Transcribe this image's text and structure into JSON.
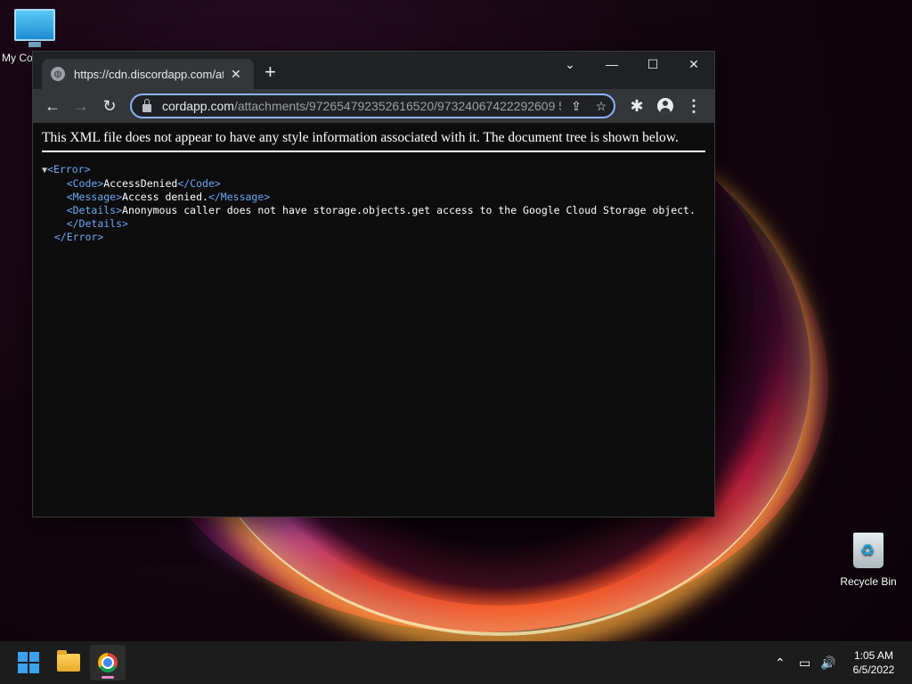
{
  "desktop": {
    "icons": [
      {
        "label": "My Co",
        "icon": "monitor-icon"
      },
      {
        "label": "Recycle Bin",
        "icon": "recycle-bin-icon"
      }
    ]
  },
  "browser": {
    "tab": {
      "title": "https://cdn.discordapp.com/attac",
      "favicon": "globe-icon",
      "close": "✕"
    },
    "new_tab": "+",
    "window_controls": {
      "tab_search": "⌄",
      "minimize": "—",
      "maximize": "☐",
      "close": "✕"
    },
    "toolbar": {
      "back": "←",
      "forward": "→",
      "reload": "↻"
    },
    "address": {
      "host": "cordapp.com",
      "path": "/attachments/972654792352616520/97324067422292609 5"
    },
    "omnibox_icons": {
      "share": "⇪",
      "bookmark": "☆"
    },
    "extensions": "✱",
    "menu": "⋮"
  },
  "page": {
    "banner": "This XML file does not appear to have any style information associated with it. The document tree is shown below.",
    "xml": {
      "toggle": "▼",
      "error_open": "<Error>",
      "code_open": "<Code>",
      "code_value": "AccessDenied",
      "code_close": "</Code>",
      "message_open": "<Message>",
      "message_value": "Access denied.",
      "message_close": "</Message>",
      "details_open": "<Details>",
      "details_value": "Anonymous caller does not have storage.objects.get access to the Google Cloud Storage object.",
      "details_close": "</Details>",
      "error_close": "</Error>"
    }
  },
  "taskbar": {
    "apps": [
      "start-icon",
      "file-explorer-icon",
      "chrome-icon"
    ],
    "tray": {
      "chevron": "⌃",
      "network": "▭",
      "volume": "🔊"
    },
    "time": "1:05 AM",
    "date": "6/5/2022"
  },
  "colors": {
    "accent": "#8ab4f8",
    "xml_tag": "#6aa9f4",
    "toolbar": "#35363a",
    "titlebar": "#202124"
  }
}
